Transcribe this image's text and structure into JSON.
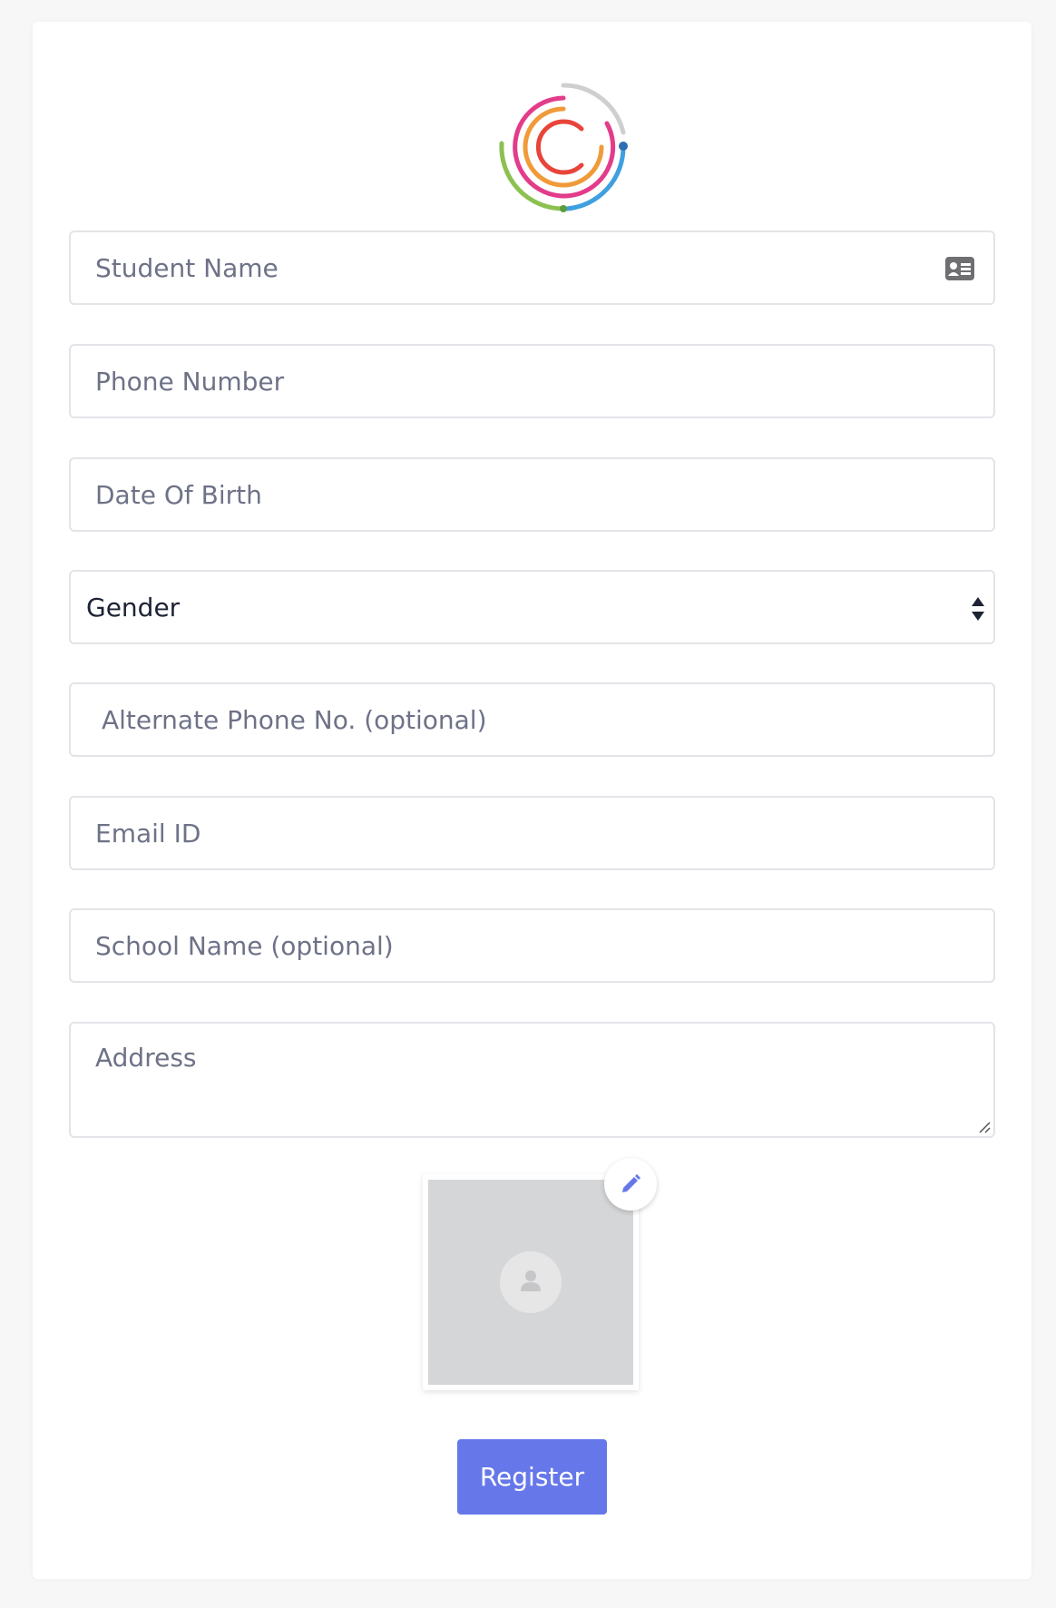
{
  "form": {
    "student_name": {
      "placeholder": "Student Name",
      "icon": "id-card-icon"
    },
    "phone_number": {
      "placeholder": "Phone Number"
    },
    "date_of_birth": {
      "placeholder": "Date Of Birth"
    },
    "gender": {
      "selected": "Gender",
      "icon": "select-arrows-icon"
    },
    "alternate_phone": {
      "placeholder": "Alternate Phone No. (optional)"
    },
    "email": {
      "placeholder": "Email ID"
    },
    "school_name": {
      "placeholder": "School Name (optional)"
    },
    "address": {
      "placeholder": "Address"
    },
    "photo": {
      "placeholder_icon": "user-icon",
      "edit_icon": "pencil-icon"
    },
    "register_label": "Register"
  },
  "colors": {
    "accent": "#6677ea",
    "border": "#e3e4e8",
    "placeholder_text": "#6e7287",
    "photo_bg": "#d5d6d8"
  }
}
